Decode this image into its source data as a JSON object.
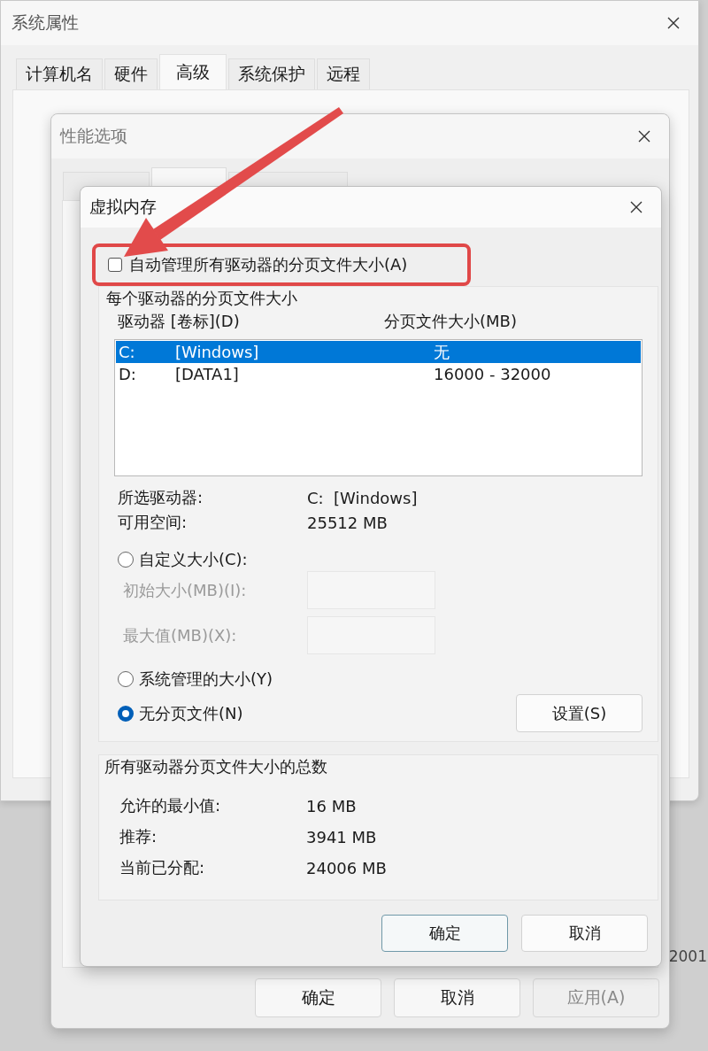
{
  "system_properties": {
    "title": "系统属性",
    "tabs": [
      {
        "label": "计算机名",
        "selected": false
      },
      {
        "label": "硬件",
        "selected": false
      },
      {
        "label": "高级",
        "selected": true
      },
      {
        "label": "系统保护",
        "selected": false
      },
      {
        "label": "远程",
        "selected": false
      }
    ]
  },
  "background_window": {
    "text": "2001"
  },
  "performance_options": {
    "title": "性能选项",
    "tabs": [
      {
        "selected": false
      },
      {
        "selected": true
      },
      {
        "selected": false
      }
    ],
    "buttons": [
      {
        "label": "确定",
        "disabled": false
      },
      {
        "label": "取消",
        "disabled": false
      },
      {
        "label": "应用(A)",
        "disabled": true
      }
    ]
  },
  "virtual_memory": {
    "title": "虚拟内存",
    "auto_manage": {
      "label": "自动管理所有驱动器的分页文件大小(A)",
      "checked": false
    },
    "per_drive": {
      "title": "每个驱动器的分页文件大小",
      "columns": [
        "驱动器 [卷标](D)",
        "分页文件大小(MB)"
      ],
      "rows": [
        {
          "drive": "C:",
          "volume": "[Windows]",
          "size": "无",
          "selected": true
        },
        {
          "drive": "D:",
          "volume": "[DATA1]",
          "size": "16000 - 32000",
          "selected": false
        }
      ],
      "info": [
        {
          "label": "所选驱动器:",
          "value": "C:  [Windows]"
        },
        {
          "label": "可用空间:",
          "value": "25512 MB"
        }
      ],
      "options": [
        {
          "kind": "radio",
          "label": "自定义大小(C):",
          "selected": false
        },
        {
          "kind": "field",
          "label": "初始大小(MB)(I):",
          "disabled": true
        },
        {
          "kind": "field",
          "label": "最大值(MB)(X):",
          "disabled": true
        },
        {
          "kind": "radio",
          "label": "系统管理的大小(Y)",
          "selected": false
        },
        {
          "kind": "radio",
          "label": "无分页文件(N)",
          "selected": true
        }
      ],
      "set_button": "设置(S)"
    },
    "totals": {
      "title": "所有驱动器分页文件大小的总数",
      "rows": [
        {
          "label": "允许的最小值:",
          "value": "16 MB"
        },
        {
          "label": "推荐:",
          "value": "3941 MB"
        },
        {
          "label": "当前已分配:",
          "value": "24006 MB"
        }
      ]
    },
    "buttons": [
      {
        "label": "确定",
        "default": true
      },
      {
        "label": "取消",
        "default": false
      }
    ]
  }
}
